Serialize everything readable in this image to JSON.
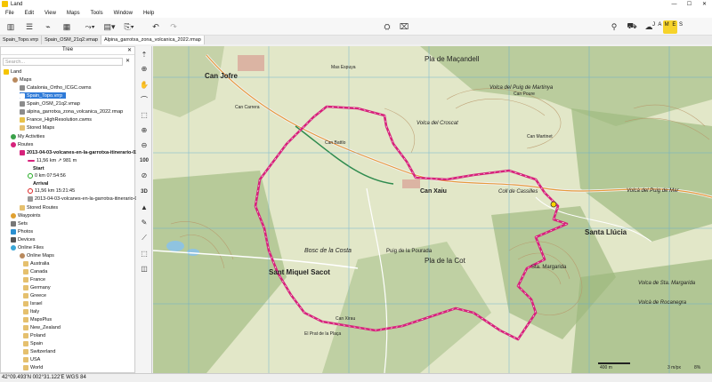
{
  "window": {
    "title": "Land",
    "min": "—",
    "max": "☐",
    "close": "✕"
  },
  "menu": [
    "File",
    "Edit",
    "View",
    "Maps",
    "Tools",
    "Window",
    "Help"
  ],
  "user": {
    "name": "J A M E S"
  },
  "tabs": [
    "Spain_Topo.vrrp",
    "Spain_OSM_21q2.vmap",
    "Alpina_garrotxa_zona_volcanica_2022.rmap"
  ],
  "tree": {
    "header": "Tree",
    "search_placeholder": "Search...",
    "items": [
      {
        "label": "Land",
        "kind": "root"
      },
      {
        "label": "Maps"
      },
      {
        "label": "Catalonia_Ortho_ICGC.cwms"
      },
      {
        "label": "Spain_Topo.vrrp",
        "selected": true
      },
      {
        "label": "Spain_OSM_21q2.vmap"
      },
      {
        "label": "alpina_garrotxa_zona_volcanica_2022.rmap"
      },
      {
        "label": "France_HighResolution.cwms"
      },
      {
        "label": "Stored Maps"
      },
      {
        "label": "My Activities"
      },
      {
        "label": "Routes"
      },
      {
        "label": "2013-04-03-volcanes-en-la-garrotxa-itinerario-02"
      },
      {
        "label": "11,56 km  ↗ 981 m"
      },
      {
        "label": "Start"
      },
      {
        "label": "0 km   07:54:56"
      },
      {
        "label": "Arrival"
      },
      {
        "label": "11,56 km   15:21:45"
      },
      {
        "label": "2013-04-03-volcanes-en-la-garrotxa-itinerario-02.trk"
      },
      {
        "label": "Stored Routes"
      },
      {
        "label": "Waypoints"
      },
      {
        "label": "Sets"
      },
      {
        "label": "Photos"
      },
      {
        "label": "Devices"
      },
      {
        "label": "Online Files"
      },
      {
        "label": "Online Maps"
      },
      {
        "label": "Australia"
      },
      {
        "label": "Canada"
      },
      {
        "label": "France"
      },
      {
        "label": "Germany"
      },
      {
        "label": "Greece"
      },
      {
        "label": "Israel"
      },
      {
        "label": "Italy"
      },
      {
        "label": "MapsPlus"
      },
      {
        "label": "New_Zealand"
      },
      {
        "label": "Poland"
      },
      {
        "label": "Spain"
      },
      {
        "label": "Switzerland"
      },
      {
        "label": "USA"
      },
      {
        "label": "World"
      }
    ]
  },
  "map": {
    "labels": [
      "Can Jofre",
      "Pla de Maçandell",
      "Volca del Puig de Martinya",
      "Volca del Croscat",
      "Can Battlo",
      "Can Poure",
      "Can Xaiu",
      "Coll de Cassilles",
      "Can Martinet",
      "Santa Llúcia",
      "Volcà del Puig de Mar",
      "Bosc de la Costa",
      "Pla de la Cot",
      "Puig de la Pourada",
      "Sant Miquel Sacot",
      "Sta. Margarida",
      "Volca de Sta. Margarida",
      "Volcà de Rocanegra",
      "El Prat de la Plaça",
      "Can Xirau",
      "Mas Espuya",
      "Can Carrera"
    ],
    "scale_left": "400 m",
    "scale_right": "3 m/px",
    "zoom": "8%"
  },
  "status": {
    "coords": "42°09.493'N 002°31.122'E  WGS 84"
  },
  "colors": {
    "track": "#d6227b",
    "selection": "#2f7bd8",
    "map_green": "#7fa86b"
  }
}
